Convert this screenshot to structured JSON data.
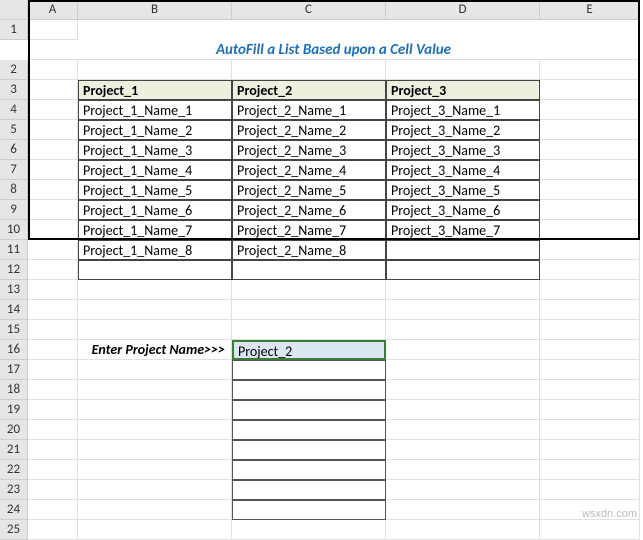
{
  "columns": [
    "A",
    "B",
    "C",
    "D",
    "E"
  ],
  "title": "AutoFill a List Based upon a Cell Value",
  "table": {
    "headers": [
      "Project_1",
      "Project_2",
      "Project_3"
    ],
    "rows": [
      [
        "Project_1_Name_1",
        "Project_2_Name_1",
        "Project_3_Name_1"
      ],
      [
        "Project_1_Name_2",
        "Project_2_Name_2",
        "Project_3_Name_2"
      ],
      [
        "Project_1_Name_3",
        "Project_2_Name_3",
        "Project_3_Name_3"
      ],
      [
        "Project_1_Name_4",
        "Project_2_Name_4",
        "Project_3_Name_4"
      ],
      [
        "Project_1_Name_5",
        "Project_2_Name_5",
        "Project_3_Name_5"
      ],
      [
        "Project_1_Name_6",
        "Project_2_Name_6",
        "Project_3_Name_6"
      ],
      [
        "Project_1_Name_7",
        "Project_2_Name_7",
        "Project_3_Name_7"
      ],
      [
        "Project_1_Name_8",
        "Project_2_Name_8",
        ""
      ]
    ]
  },
  "prompt_label": "Enter Project Name>>>",
  "selected_value": "Project_2",
  "result_rows": 8,
  "watermark": "wsxdn.com",
  "total_rows": 25
}
